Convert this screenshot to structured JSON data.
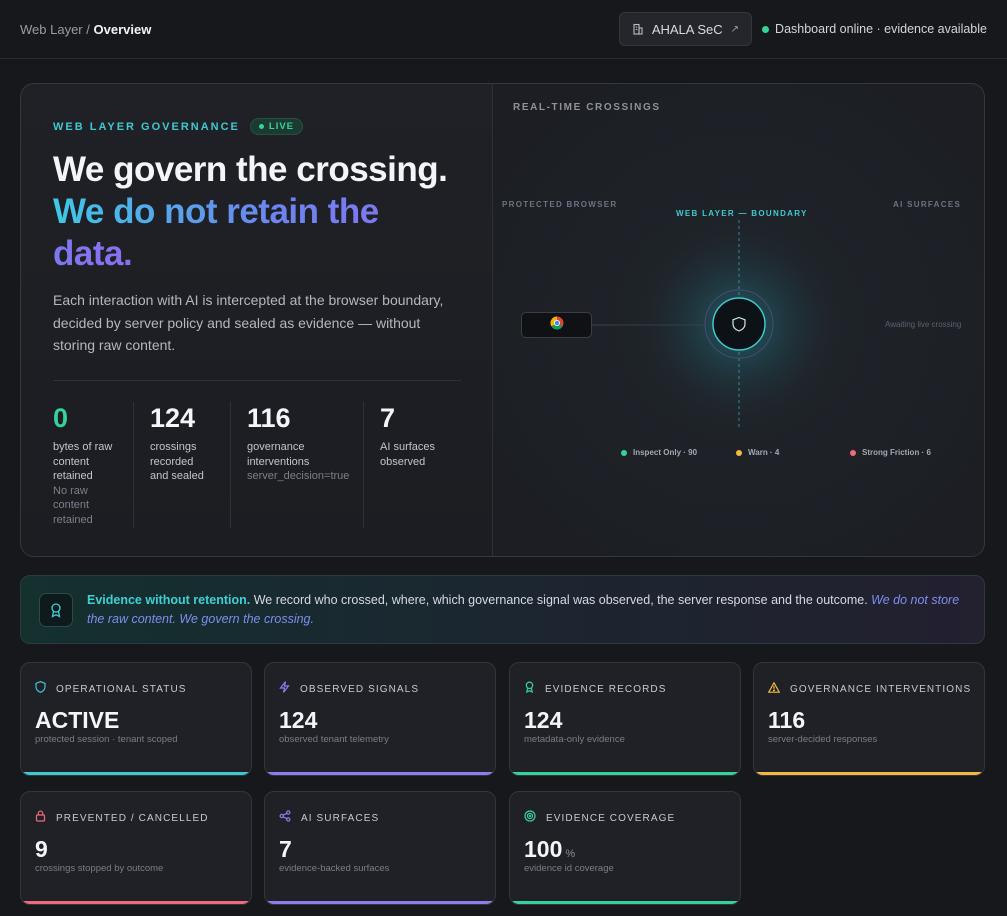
{
  "topbar": {
    "breadcrumb_root": "Web Layer",
    "breadcrumb_sep": "/",
    "breadcrumb_current": "Overview",
    "org_label": "AHALA SeC",
    "org_external_icon": "↗",
    "status_text": "Dashboard online · evidence available"
  },
  "hero": {
    "eyebrow": "WEB LAYER GOVERNANCE",
    "live_label": "LIVE",
    "headline_1": "We govern the crossing.",
    "headline_2": "We do not retain the data.",
    "lede": "Each interaction with AI is intercepted at the browser boundary, decided by server policy and sealed as evidence — without storing raw content.",
    "stats": [
      {
        "value": "0",
        "label": "bytes of raw content retained",
        "sub": "No raw content retained"
      },
      {
        "value": "124",
        "label": "crossings recorded and sealed",
        "sub": ""
      },
      {
        "value": "116",
        "label": "governance interventions",
        "sub": "server_decision=true"
      },
      {
        "value": "7",
        "label": "AI surfaces observed",
        "sub": ""
      }
    ]
  },
  "viz": {
    "title": "REAL-TIME CROSSINGS",
    "protected_browser": "PROTECTED BROWSER",
    "boundary": "WEB LAYER — BOUNDARY",
    "ai_surfaces": "AI SURFACES",
    "awaiting": "Awaiting live crossing",
    "legend": [
      {
        "label": "Inspect Only · 90",
        "color": "#34d399"
      },
      {
        "label": "Warn · 4",
        "color": "#f5b841"
      },
      {
        "label": "Strong Friction · 6",
        "color": "#f06a7a"
      }
    ]
  },
  "banner": {
    "strong": "Evidence without retention.",
    "body": " We record who crossed, where, which governance signal was observed, the server response and the outcome. ",
    "em": "We do not store the raw content. We govern the crossing."
  },
  "cards": [
    {
      "title": "OPERATIONAL STATUS",
      "value": "ACTIVE",
      "unit": "",
      "sub": "protected session · tenant scoped",
      "icon": "shield-icon",
      "color": "#3fc8cf"
    },
    {
      "title": "OBSERVED SIGNALS",
      "value": "124",
      "unit": "",
      "sub": "observed tenant telemetry",
      "icon": "bolt-icon",
      "color": "#8f7cf0"
    },
    {
      "title": "EVIDENCE RECORDS",
      "value": "124",
      "unit": "",
      "sub": "metadata-only evidence",
      "icon": "award-icon",
      "color": "#34d399"
    },
    {
      "title": "GOVERNANCE INTERVENTIONS",
      "value": "116",
      "unit": "",
      "sub": "server-decided responses",
      "icon": "warning-icon",
      "color": "#f5b841"
    },
    {
      "title": "PREVENTED / CANCELLED",
      "value": "9",
      "unit": "",
      "sub": "crossings stopped by outcome",
      "icon": "lock-icon",
      "color": "#f06a7a"
    },
    {
      "title": "AI SURFACES",
      "value": "7",
      "unit": "",
      "sub": "evidence-backed surfaces",
      "icon": "share-icon",
      "color": "#8f7cf0"
    },
    {
      "title": "EVIDENCE COVERAGE",
      "value": "100",
      "unit": "%",
      "sub": "evidence id coverage",
      "icon": "target-icon",
      "color": "#34d399"
    }
  ]
}
